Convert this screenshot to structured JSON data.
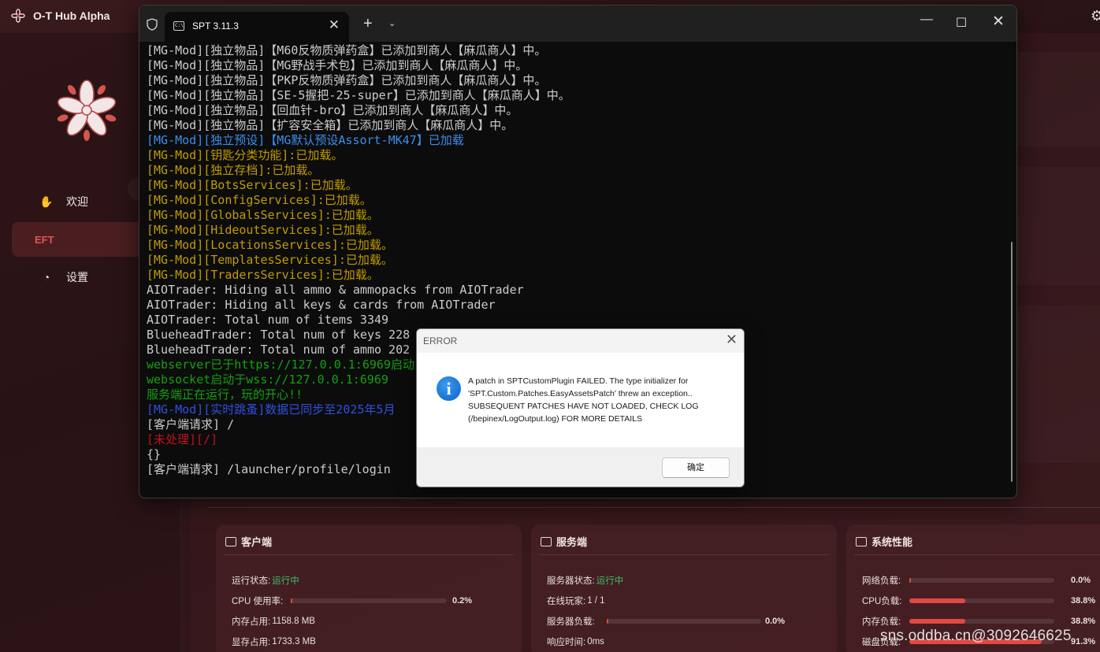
{
  "app": {
    "title": "O-T Hub Alpha",
    "gear_glyph": "⚙",
    "nav": [
      {
        "icon": "hand-icon",
        "glyph": "✋",
        "label": "欢迎"
      },
      {
        "icon": "none",
        "glyph": "",
        "label": "EFT"
      },
      {
        "icon": "palette-icon",
        "glyph": "◔",
        "label": "设置"
      }
    ],
    "cards": {
      "client": {
        "title": "客户端",
        "rows": [
          {
            "key": "运行状态:",
            "value": "运行中"
          },
          {
            "key": "CPU 使用率:",
            "percent": "0.2%",
            "fraction": 0.002
          },
          {
            "key": "内存占用:",
            "value": "1158.8 MB"
          },
          {
            "key": "显存占用:",
            "value": "1733.3 MB"
          }
        ]
      },
      "server": {
        "title": "服务端",
        "rows": [
          {
            "key": "服务器状态:",
            "value": "运行中"
          },
          {
            "key": "在线玩家:",
            "value": "1 / 1"
          },
          {
            "key": "服务器负载:",
            "percent": "0.0%",
            "fraction": 0.0
          },
          {
            "key": "响应时间:",
            "value": "0ms"
          }
        ]
      },
      "system": {
        "title": "系统性能",
        "rows": [
          {
            "key": "网络负载:",
            "percent": "0.0%",
            "fraction": 0.0
          },
          {
            "key": "CPU负载:",
            "percent": "38.8%",
            "fraction": 0.388
          },
          {
            "key": "内存负载:",
            "percent": "38.8%",
            "fraction": 0.388
          },
          {
            "key": "磁盘负载:",
            "percent": "91.3%",
            "fraction": 0.913
          }
        ]
      }
    },
    "colors": {
      "accent_red": "#e04a42",
      "status_green": "#3cc06a"
    }
  },
  "terminal": {
    "tab_title": "SPT 3.11.3",
    "tab_icon_text": "C:\\",
    "new_tab_glyph": "+",
    "dropdown_glyph": "⌄",
    "close_glyph": "✕",
    "min_glyph": "—",
    "max_glyph": "☐",
    "lines": [
      {
        "color": "white",
        "text": "[MG-Mod][独立物品]【M60反物质弹药盒】已添加到商人【麻瓜商人】中。"
      },
      {
        "color": "white",
        "text": "[MG-Mod][独立物品]【MG野战手术包】已添加到商人【麻瓜商人】中。"
      },
      {
        "color": "white",
        "text": "[MG-Mod][独立物品]【PKP反物质弹药盒】已添加到商人【麻瓜商人】中。"
      },
      {
        "color": "white",
        "text": "[MG-Mod][独立物品]【SE-5握把-25-super】已添加到商人【麻瓜商人】中。"
      },
      {
        "color": "white",
        "text": "[MG-Mod][独立物品]【回血针-bro】已添加到商人【麻瓜商人】中。"
      },
      {
        "color": "white",
        "text": "[MG-Mod][独立物品]【扩容安全箱】已添加到商人【麻瓜商人】中。"
      },
      {
        "color": "blue",
        "text": "[MG-Mod][独立预设]【MG默认预设Assort-MK47】已加载"
      },
      {
        "color": "yellow",
        "text": "[MG-Mod][钥匙分类功能]:已加载。"
      },
      {
        "color": "yellow",
        "text": "[MG-Mod][独立存档]:已加载。"
      },
      {
        "color": "yellow",
        "text": "[MG-Mod][BotsServices]:已加载。"
      },
      {
        "color": "yellow",
        "text": "[MG-Mod][ConfigServices]:已加载。"
      },
      {
        "color": "yellow",
        "text": "[MG-Mod][GlobalsServices]:已加载。"
      },
      {
        "color": "yellow",
        "text": "[MG-Mod][HideoutServices]:已加载。"
      },
      {
        "color": "yellow",
        "text": "[MG-Mod][LocationsServices]:已加载。"
      },
      {
        "color": "yellow",
        "text": "[MG-Mod][TemplatesServices]:已加载。"
      },
      {
        "color": "yellow",
        "text": "[MG-Mod][TradersServices]:已加载。"
      },
      {
        "color": "white",
        "text": "AIOTrader: Hiding all ammo & ammopacks from AIOTrader"
      },
      {
        "color": "white",
        "text": "AIOTrader: Hiding all keys & cards from AIOTrader"
      },
      {
        "color": "white",
        "text": "AIOTrader: Total num of items 3349"
      },
      {
        "color": "white",
        "text": "BlueheadTrader: Total num of keys 228"
      },
      {
        "color": "white",
        "text": "BlueheadTrader: Total num of ammo 202"
      },
      {
        "color": "green",
        "text": "webserver已于https://127.0.0.1:6969启动"
      },
      {
        "color": "green",
        "text": "websocket启动于wss://127.0.0.1:6969"
      },
      {
        "color": "green",
        "text": "服务端正在运行，玩的开心!!"
      },
      {
        "color": "dblue",
        "text": "[MG-Mod][实时跳蚤]数据已同步至2025年5月"
      },
      {
        "color": "white",
        "text": "[客户端请求] /"
      },
      {
        "color": "red",
        "text": "[未处理][/]"
      },
      {
        "color": "white",
        "text": "{}"
      },
      {
        "color": "white",
        "text": "[客户端请求] /launcher/profile/login"
      }
    ]
  },
  "dialog": {
    "title": "ERROR",
    "close_glyph": "✕",
    "info_glyph": "i",
    "message_lines": [
      "A patch in SPTCustomPlugin FAILED. The type initializer for",
      "'SPT.Custom.Patches.EasyAssetsPatch' threw an exception..",
      "SUBSEQUENT PATCHES HAVE NOT LOADED, CHECK LOG",
      "(/bepinex/LogOutput.log) FOR MORE DETAILS"
    ],
    "ok_label": "确定"
  },
  "watermark": "sns.oddba.cn@3092646625"
}
